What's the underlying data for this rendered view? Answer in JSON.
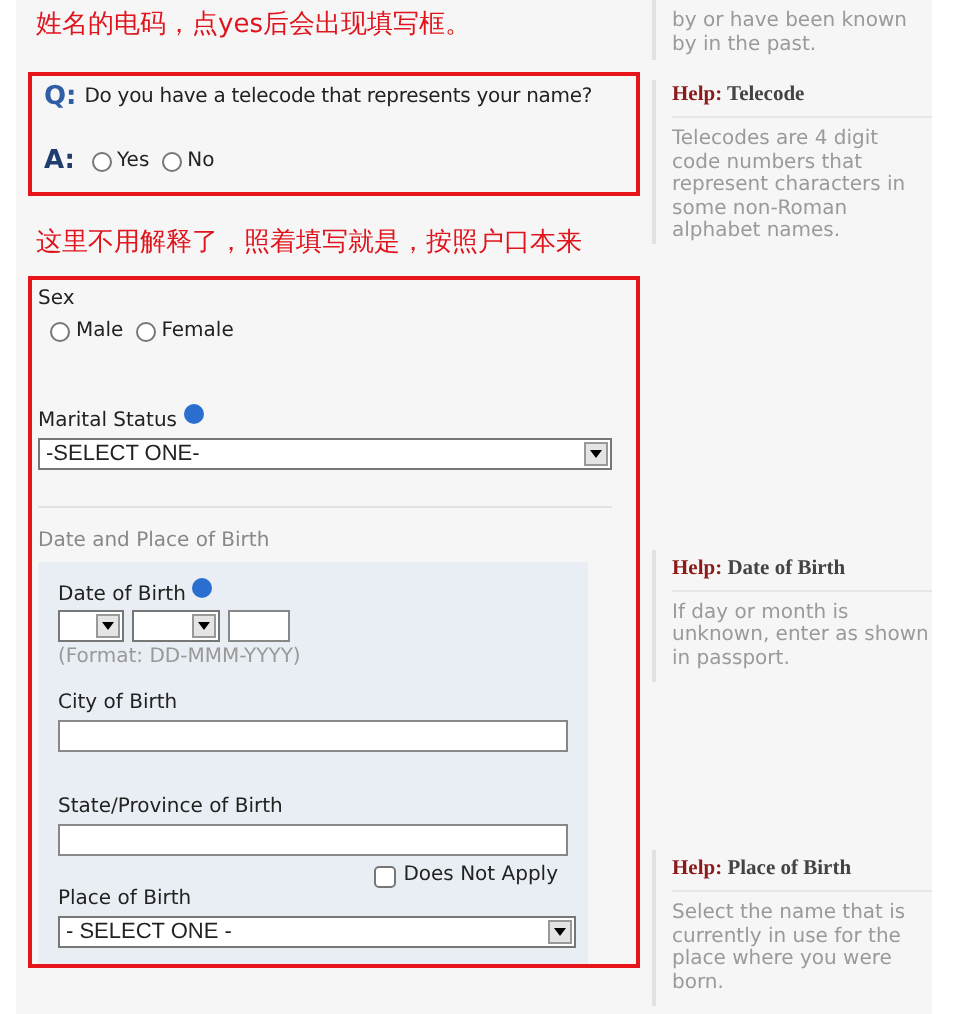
{
  "annotations": [
    "姓名的电码，点yes后会出现填写框。",
    "这里不用解释了，照着填写就是，按照户口本来"
  ],
  "top_help": {
    "text": "by or have been known by in the past."
  },
  "question": {
    "q_label": "Q:",
    "text": "Do you have a telecode that represents your name?",
    "a_label": "A:",
    "options": [
      {
        "label": "Yes",
        "selected": false
      },
      {
        "label": "No",
        "selected": false
      }
    ]
  },
  "personal": {
    "sex": {
      "label": "Sex",
      "options": [
        {
          "label": "Male",
          "selected": false
        },
        {
          "label": "Female",
          "selected": false
        }
      ]
    },
    "marital_status": {
      "label": "Marital Status",
      "value": "-SELECT ONE-"
    },
    "section_title": "Date and Place of Birth",
    "date_of_birth": {
      "label": "Date of Birth",
      "format": "(Format: DD-MMM-YYYY)"
    },
    "city_of_birth": {
      "label": "City of Birth"
    },
    "state_of_birth": {
      "label": "State/Province of Birth",
      "does_not_apply": {
        "label": "Does Not Apply",
        "checked": false
      }
    },
    "place_of_birth": {
      "label": "Place of Birth",
      "value": "- SELECT ONE -"
    }
  },
  "help": [
    {
      "prefix": "Help:",
      "title": "Telecode",
      "text": "Telecodes are 4 digit code numbers that represent characters in some non-Roman alphabet names."
    },
    {
      "prefix": "Help:",
      "title": "Date of Birth",
      "text": "If day or month is unknown, enter as shown in passport."
    },
    {
      "prefix": "Help:",
      "title": "Place of Birth",
      "text": "Select the name that is currently in use for the place where you were born."
    }
  ]
}
